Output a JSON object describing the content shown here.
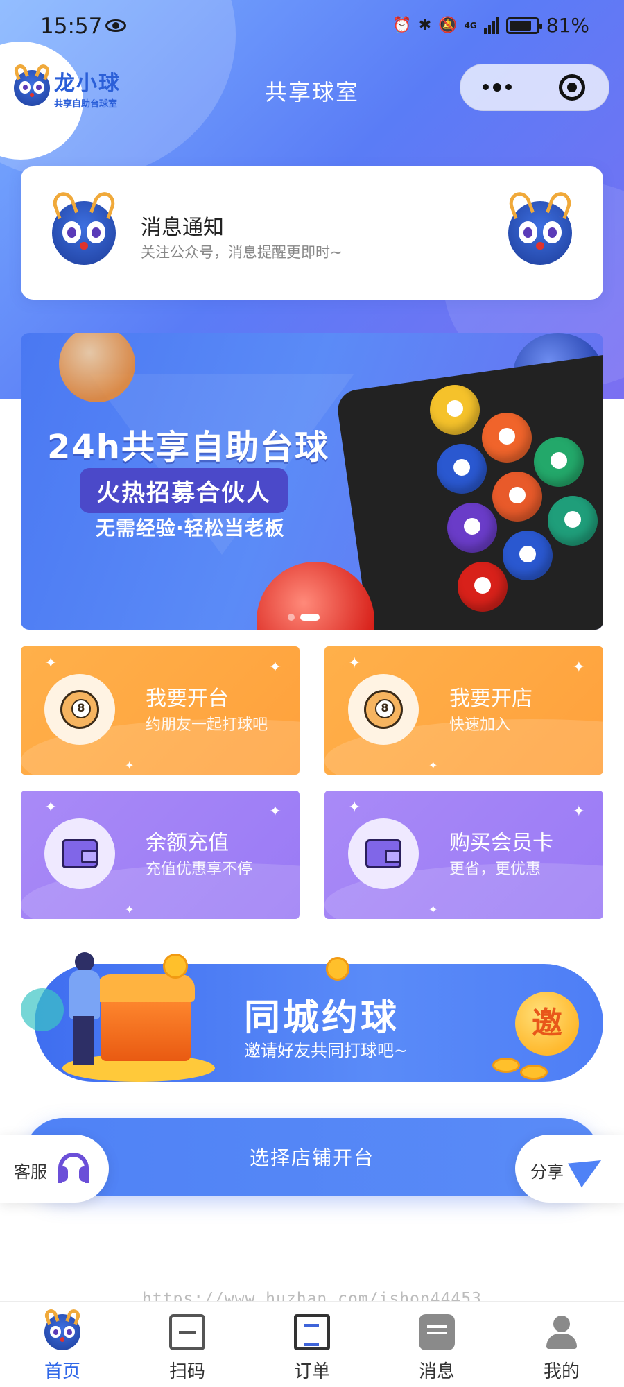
{
  "status_bar": {
    "time": "15:57",
    "network": "4G",
    "battery": "81%"
  },
  "header": {
    "brand_name": "龙小球",
    "brand_sub": "共享自助台球室",
    "title": "共享球室"
  },
  "notice": {
    "title": "消息通知",
    "subtitle": "关注公众号，消息提醒更即时~"
  },
  "banner": {
    "headline": "24h共享自助台球",
    "pill": "火热招募合伙人",
    "tagline": "无需经验·轻松当老板",
    "slides_total": 2,
    "slide_active": 2
  },
  "cards": [
    {
      "title": "我要开台",
      "subtitle": "约朋友一起打球吧",
      "icon": "billiard-ball-icon",
      "theme": "#ffa13c"
    },
    {
      "title": "我要开店",
      "subtitle": "快速加入",
      "icon": "billiard-ball-icon",
      "theme": "#ffa13c"
    },
    {
      "title": "余额充值",
      "subtitle": "充值优惠享不停",
      "icon": "wallet-icon",
      "theme": "#9a7af5"
    },
    {
      "title": "购买会员卡",
      "subtitle": "更省，更优惠",
      "icon": "wallet-icon",
      "theme": "#9a7af5"
    }
  ],
  "invite": {
    "title": "同城约球",
    "subtitle": "邀请好友共同打球吧~",
    "badge": "邀"
  },
  "actions": {
    "select_store": "选择店铺开台",
    "service": "客服",
    "share": "分享"
  },
  "watermark": "https://www.huzhan.com/ishop44453",
  "tabbar": [
    {
      "label": "首页",
      "icon": "home-mascot-icon",
      "active": true
    },
    {
      "label": "扫码",
      "icon": "scan-icon",
      "active": false
    },
    {
      "label": "订单",
      "icon": "order-icon",
      "active": false
    },
    {
      "label": "消息",
      "icon": "message-icon",
      "active": false
    },
    {
      "label": "我的",
      "icon": "profile-icon",
      "active": false
    }
  ],
  "colors": {
    "primary": "#4f82f6",
    "active_tab": "#2f67e8",
    "orange_card": "#ffa13c",
    "purple_card": "#9a7af5"
  }
}
